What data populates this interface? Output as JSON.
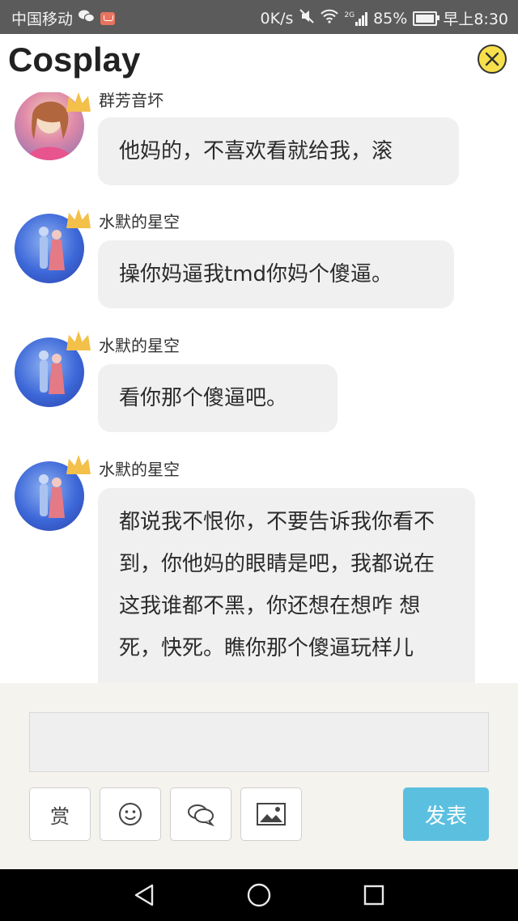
{
  "status_bar": {
    "carrier": "中国移动",
    "speed": "0K/s",
    "network": "2G",
    "battery": "85%",
    "time": "早上8:30"
  },
  "header": {
    "title": "Cosplay",
    "accent_color": "#f7e04b"
  },
  "messages": [
    {
      "username": "群芳音坏",
      "text": "他妈的，不喜欢看就给我，滚"
    },
    {
      "username": "水默的星空",
      "text": "操你妈逼我tmd你妈个傻逼。"
    },
    {
      "username": "水默的星空",
      "text": "看你那个傻逼吧。"
    },
    {
      "username": "水默的星空",
      "text": "都说我不恨你，不要告诉我你看不到，你他妈的眼睛是吧，我都说在这我谁都不黑，你还想在想咋 想死，快死。瞧你那个傻逼玩样儿"
    }
  ],
  "composer": {
    "input_value": "",
    "reward_label": "赏",
    "send_label": "发表",
    "send_color": "#5bc0e0"
  },
  "icons": {
    "emoji": "smiley-icon",
    "comment": "chat-bubbles-icon",
    "image": "image-icon",
    "back": "back-triangle-icon",
    "home": "home-circle-icon",
    "recent": "recent-square-icon"
  }
}
